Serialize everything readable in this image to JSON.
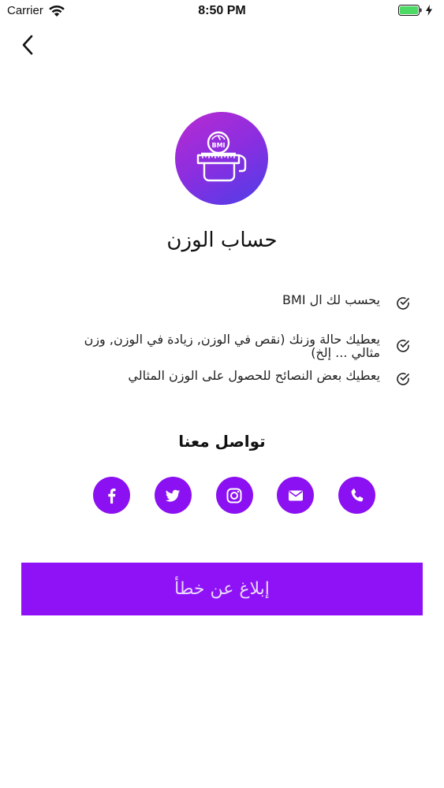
{
  "status_bar": {
    "carrier": "Carrier",
    "time": "8:50 PM"
  },
  "nav": {
    "back_icon": "chevron-left-icon"
  },
  "app": {
    "logo_icon": "bmi-scale-measuring-tape-icon",
    "logo_text": "BMI",
    "title": "حساب الوزن"
  },
  "features": [
    {
      "text": "يحسب لك ال  BMI",
      "icon": "check-circle-icon"
    },
    {
      "text": "يعطيك حالة وزنك (نقص في الوزن, زيادة في الوزن, وزن مثالي ... إلخ)",
      "icon": "check-circle-icon"
    },
    {
      "text": "يعطيك بعض النصائح للحصول على الوزن المثالي",
      "icon": "check-circle-icon"
    }
  ],
  "contact": {
    "heading": "تواصل معنا",
    "items": [
      {
        "name": "facebook",
        "icon": "facebook-icon"
      },
      {
        "name": "twitter",
        "icon": "twitter-icon"
      },
      {
        "name": "instagram",
        "icon": "instagram-icon"
      },
      {
        "name": "email",
        "icon": "envelope-icon"
      },
      {
        "name": "phone",
        "icon": "phone-icon"
      }
    ]
  },
  "report_button": {
    "label": "إبلاغ عن خطأ"
  },
  "colors": {
    "accent": "#8e12f5",
    "gradient_start": "#b92bd1",
    "gradient_end": "#4d3ee8",
    "text": "#111111"
  }
}
